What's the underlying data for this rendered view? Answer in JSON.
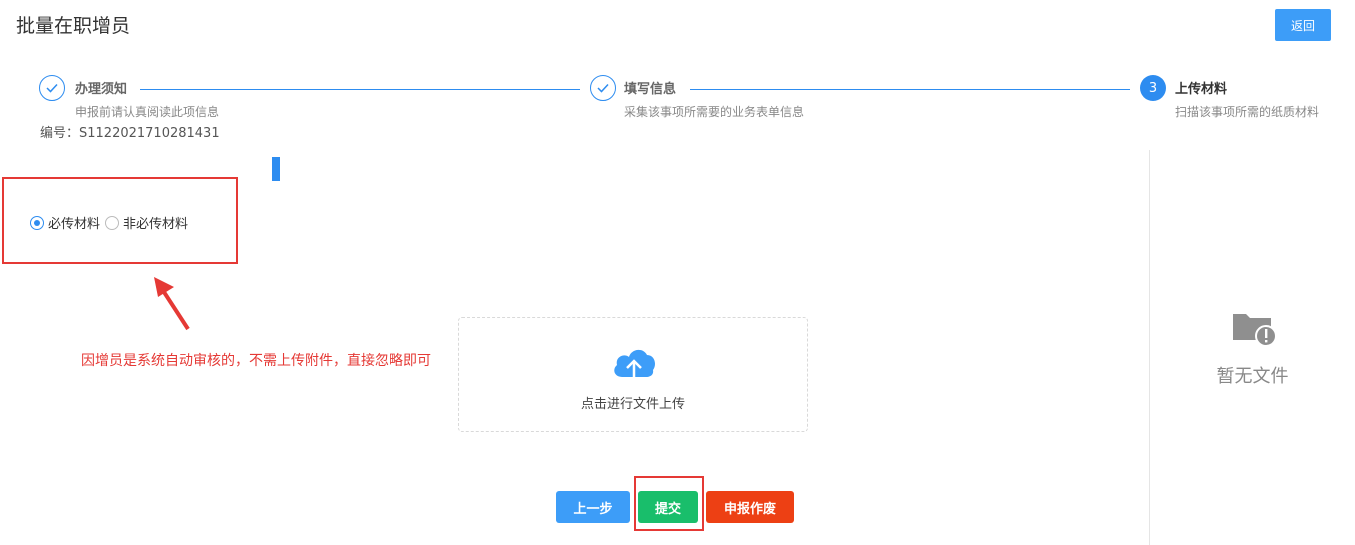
{
  "header": {
    "title": "批量在职增员",
    "back_label": "返回"
  },
  "steps": [
    {
      "title": "办理须知",
      "desc": "申报前请认真阅读此项信息",
      "status": "done"
    },
    {
      "title": "填写信息",
      "desc": "采集该事项所需要的业务表单信息",
      "status": "done"
    },
    {
      "number": "3",
      "title": "上传材料",
      "desc": "扫描该事项所需的纸质材料",
      "status": "active"
    }
  ],
  "serial": "编号：S1122021710281431",
  "material_filter": {
    "options": [
      {
        "label": "必传材料",
        "checked": true
      },
      {
        "label": "非必传材料",
        "checked": false
      }
    ]
  },
  "annotation": "因增员是系统自动审核的，不需上传附件，直接忽略即可",
  "upload": {
    "label": "点击进行文件上传"
  },
  "actions": {
    "prev": "上一步",
    "submit": "提交",
    "void": "申报作废"
  },
  "sidebar": {
    "empty_text": "暂无文件"
  },
  "colors": {
    "primary": "#2d8cf0",
    "success": "#19be6b",
    "danger": "#ed4014",
    "highlight": "#e53935"
  }
}
